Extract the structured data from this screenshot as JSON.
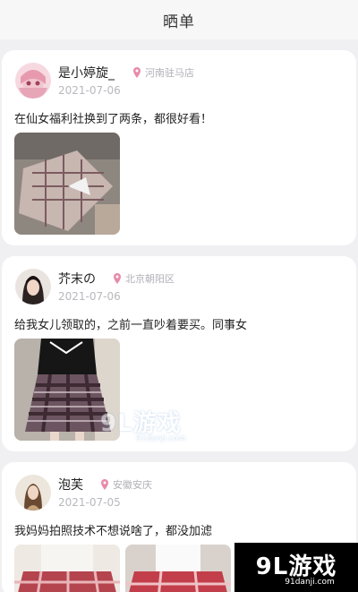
{
  "header": {
    "title": "晒单"
  },
  "posts": [
    {
      "username": "是小婷旋_",
      "location": "河南驻马店",
      "date": "2021-07-06",
      "text": "在仙女福利社换到了两条，都很好看！"
    },
    {
      "username": "芥末の",
      "location": "北京朝阳区",
      "date": "2021-07-06",
      "text": "给我女儿领取的，之前一直吵着要买。同事女"
    },
    {
      "username": "泡芙",
      "location": "安徽安庆",
      "date": "2021-07-05",
      "text": "我妈妈拍照技术不想说啥了，都没加滤"
    }
  ],
  "watermark": {
    "main": "9L游戏",
    "sub": "91danji.com"
  },
  "corner_badge": {
    "main": "9L游戏",
    "sub": "91danji.com"
  },
  "colors": {
    "location_pin": "#e88aa8",
    "background": "#f0f0f2",
    "card": "#ffffff"
  }
}
